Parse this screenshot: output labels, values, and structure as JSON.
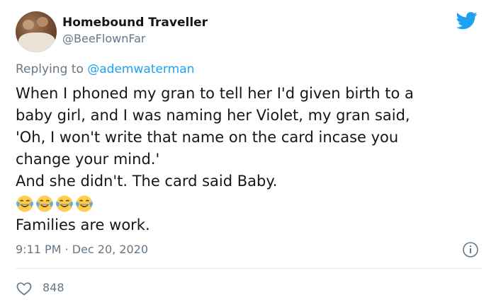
{
  "author": {
    "display_name": "Homebound Traveller",
    "handle": "@BeeFlownFar",
    "avatar_icon": "avatar-photo"
  },
  "brand_icon": "twitter-bird-icon",
  "reply": {
    "prefix": "Replying to",
    "target": "@ademwaterman"
  },
  "body": {
    "lines": [
      "When I phoned my gran to tell her I'd given birth to a",
      "baby girl, and I was naming her Violet, my gran said,",
      "'Oh, I won't write that name on the card incase you",
      "change your mind.'",
      "And she didn't. The card said Baby."
    ],
    "emojis": [
      "😂",
      "😂",
      "😂",
      "😂"
    ],
    "closing": "Families are work."
  },
  "meta": {
    "time": "9:11 PM",
    "separator": "·",
    "date": "Dec 20, 2020"
  },
  "actions": {
    "like_count": "848",
    "like_icon": "heart-icon",
    "info_icon": "info-icon"
  },
  "colors": {
    "brand": "#1da1f2",
    "text": "#14171a",
    "muted": "#657786",
    "divider": "#e1e8ed"
  }
}
